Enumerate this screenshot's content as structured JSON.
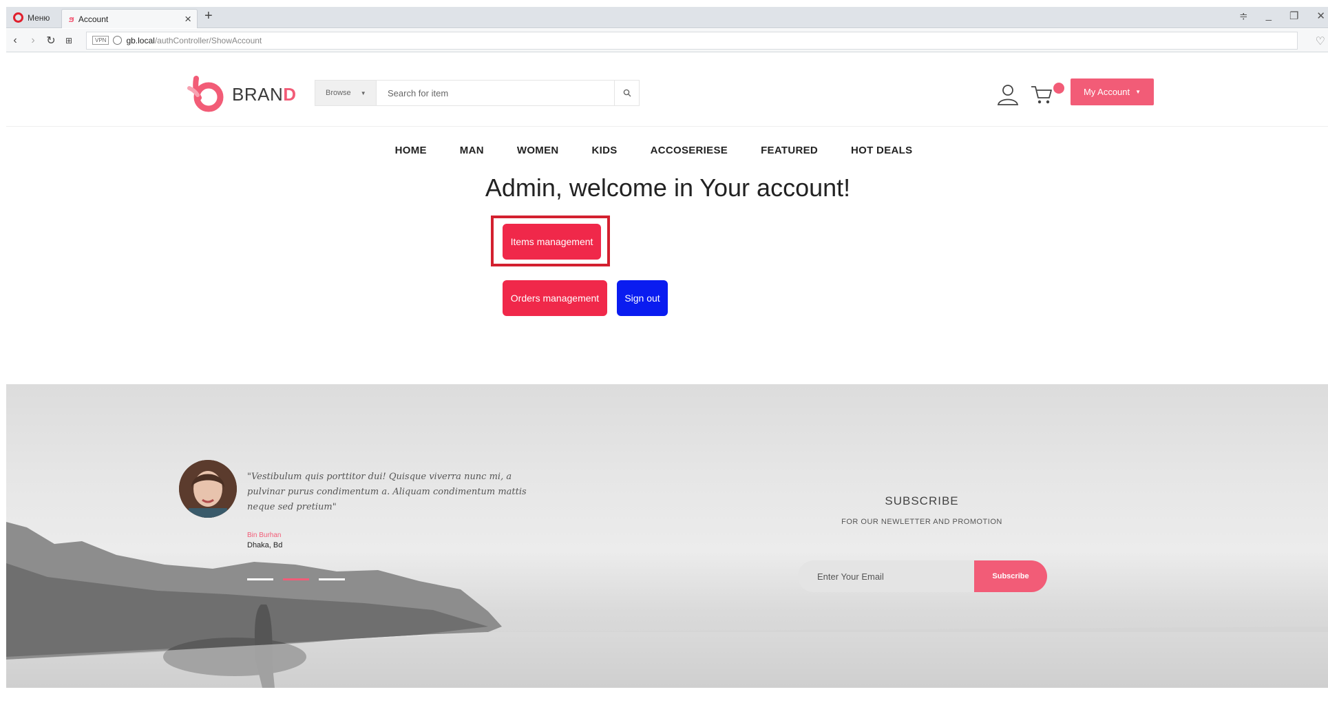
{
  "browser": {
    "menu_label": "Меню",
    "tab_title": "Account",
    "url_host": "gb.local",
    "url_path": "/authController/ShowAccount"
  },
  "header": {
    "brand_text": "BRAN",
    "brand_accent": "D",
    "browse_label": "Browse",
    "search_placeholder": "Search for item",
    "account_button": "My Account"
  },
  "nav": {
    "items": [
      "HOME",
      "MAN",
      "WOMEN",
      "KIDS",
      "ACCOSERIESE",
      "FEATURED",
      "HOT DEALS"
    ]
  },
  "account": {
    "welcome": "Admin, welcome in Your account!",
    "items_button": "Items management",
    "orders_button": "Orders management",
    "signout_button": "Sign out"
  },
  "testimonial": {
    "quote": "\"Vestibulum quis porttitor dui! Quisque viverra nunc mi, a pulvinar purus condimentum a. Aliquam condimentum mattis neque sed pretium\"",
    "author": "Bin Burhan",
    "location": "Dhaka, Bd"
  },
  "subscribe": {
    "title": "SUBSCRIBE",
    "subtitle": "FOR OUR NEWLETTER AND PROMOTION",
    "email_placeholder": "Enter Your Email",
    "button": "Subscribe"
  },
  "colors": {
    "brand_pink": "#f25c77",
    "button_red": "#f0284a",
    "signout_blue": "#0a1cf0",
    "highlight_red": "#d3202f"
  }
}
